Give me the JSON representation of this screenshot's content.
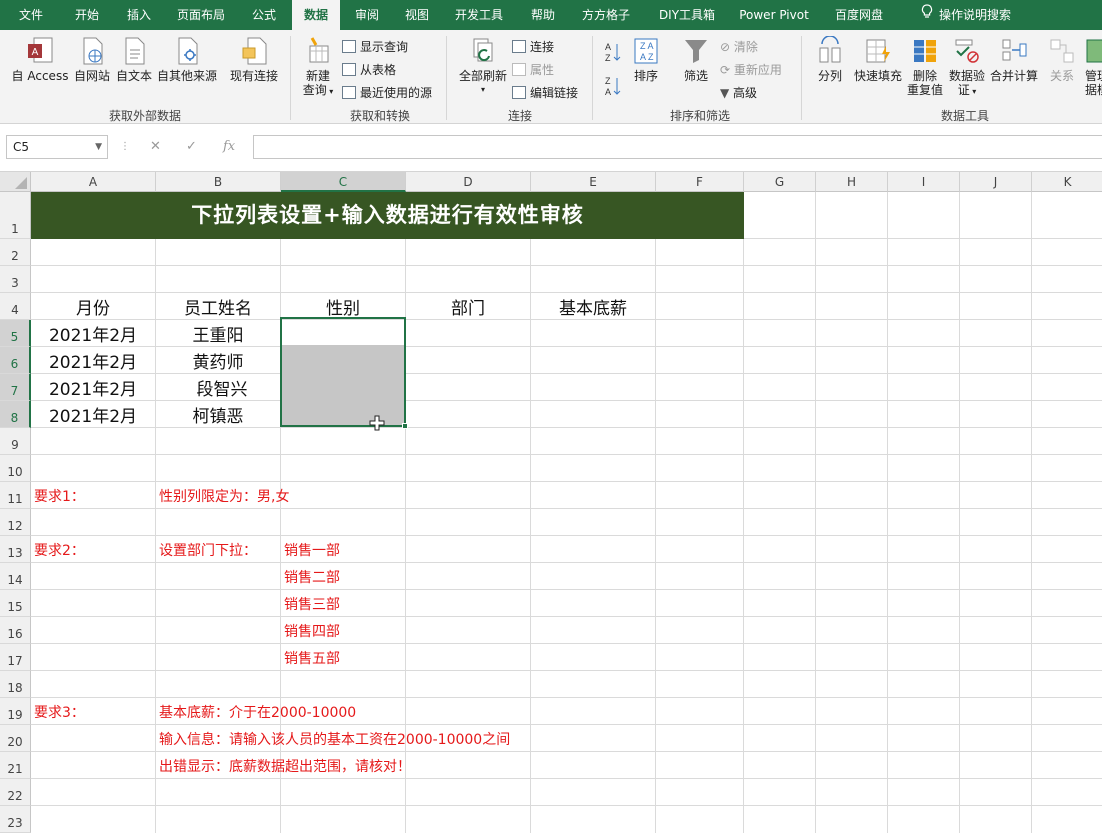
{
  "ribbon_tabs": [
    {
      "label": "文件",
      "active": false
    },
    {
      "label": "开始",
      "active": false
    },
    {
      "label": "插入",
      "active": false
    },
    {
      "label": "页面布局",
      "active": false
    },
    {
      "label": "公式",
      "active": false
    },
    {
      "label": "数据",
      "active": true
    },
    {
      "label": "审阅",
      "active": false
    },
    {
      "label": "视图",
      "active": false
    },
    {
      "label": "开发工具",
      "active": false
    },
    {
      "label": "帮助",
      "active": false
    },
    {
      "label": "方方格子",
      "active": false
    },
    {
      "label": "DIY工具箱",
      "active": false
    },
    {
      "label": "Power Pivot",
      "active": false
    },
    {
      "label": "百度网盘",
      "active": false
    },
    {
      "label": "操作说明搜索",
      "active": false
    }
  ],
  "ribbon": {
    "get_external": {
      "group_label": "获取外部数据",
      "access": "自 Access",
      "web": "自网站",
      "text": "自文本",
      "other": "自其他来源",
      "existing": "现有连接"
    },
    "get_transform": {
      "group_label": "获取和转换",
      "new_query_l1": "新建",
      "new_query_l2": "查询",
      "show_queries": "显示查询",
      "from_table": "从表格",
      "recent_sources": "最近使用的源"
    },
    "connections": {
      "group_label": "连接",
      "refresh_all": "全部刷新",
      "connections": "连接",
      "properties": "属性",
      "edit_links": "编辑链接"
    },
    "sort_filter": {
      "group_label": "排序和筛选",
      "sort": "排序",
      "filter": "筛选",
      "clear": "清除",
      "reapply": "重新应用",
      "advanced": "高级"
    },
    "data_tools": {
      "group_label": "数据工具",
      "text_to_columns": "分列",
      "flash_fill": "快速填充",
      "remove_dup_l1": "删除",
      "remove_dup_l2": "重复值",
      "validation_l1": "数据验",
      "validation_l2": "证",
      "consolidate": "合并计算",
      "relationships": "关系",
      "manage_l1": "管理",
      "manage_l2": "据模"
    }
  },
  "formula_bar": {
    "name_box": "C5",
    "cancel_symbol": "✕",
    "enter_symbol": "✓",
    "fx_symbol": "fx",
    "formula": ""
  },
  "columns": [
    "A",
    "B",
    "C",
    "D",
    "E",
    "F",
    "G",
    "H",
    "I",
    "J",
    "K"
  ],
  "rows": [
    "1",
    "2",
    "3",
    "4",
    "5",
    "6",
    "7",
    "8",
    "9",
    "10",
    "11",
    "12",
    "13",
    "14",
    "15",
    "16",
    "17",
    "18",
    "19",
    "20",
    "21",
    "22",
    "23"
  ],
  "selection": {
    "range": "C5:C8",
    "active_cell": "C5"
  },
  "sheet": {
    "title": "下拉列表设置+输入数据进行有效性审核",
    "headers": [
      "月份",
      "员工姓名",
      "性别",
      "部门",
      "基本底薪"
    ],
    "records": [
      {
        "month": "2021年2月",
        "name": "王重阳"
      },
      {
        "month": "2021年2月",
        "name": "黄药师"
      },
      {
        "month": "2021年2月",
        "name": "段智兴"
      },
      {
        "month": "2021年2月",
        "name": "柯镇恶"
      }
    ],
    "req1_label": "要求1：",
    "req1_text": "性别列限定为：男,女",
    "req2_label": "要求2：",
    "req2_text": "设置部门下拉：",
    "departments": [
      "销售一部",
      "销售二部",
      "销售三部",
      "销售四部",
      "销售五部"
    ],
    "req3_label": "要求3：",
    "req3_lines": [
      "基本底薪：介于在2000-10000",
      "输入信息：请输入该人员的基本工资在2000-10000之间",
      "出错显示：底薪数据超出范围，请核对！"
    ]
  },
  "colors": {
    "excel_green": "#217346",
    "title_band": "#375623",
    "requirement_red": "#e5191a",
    "selection_gray": "#c6c6c6"
  }
}
